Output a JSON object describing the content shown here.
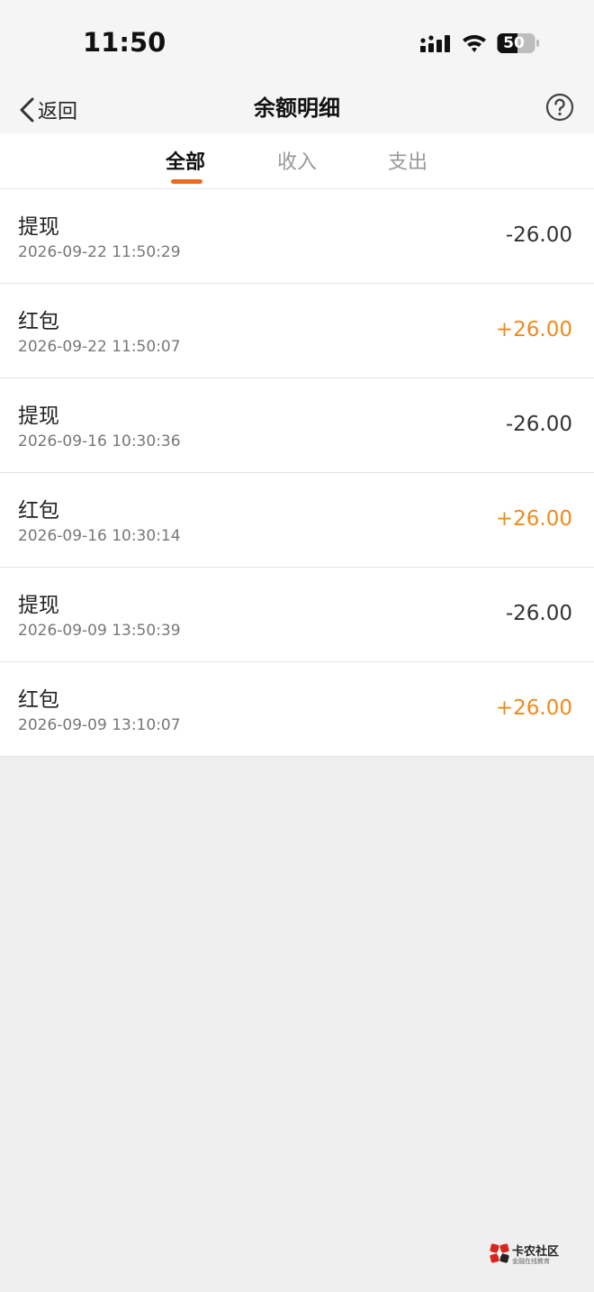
{
  "status_bar": {
    "time": "11:50",
    "battery": "50",
    "icons": [
      "signal-icon",
      "wifi-icon",
      "battery-icon"
    ]
  },
  "nav": {
    "back_label": "返回",
    "title": "余额明细",
    "help_icon": "question-circle-icon"
  },
  "tabs": [
    {
      "label": "全部",
      "active": true
    },
    {
      "label": "收入",
      "active": false
    },
    {
      "label": "支出",
      "active": false
    }
  ],
  "transactions": [
    {
      "title": "提现",
      "time": "2026-09-22 11:50:29",
      "amount": "-26.00"
    },
    {
      "title": "红包",
      "time": "2026-09-22 11:50:07",
      "amount": "+26.00"
    },
    {
      "title": "提现",
      "time": "2026-09-16 10:30:36",
      "amount": "-26.00"
    },
    {
      "title": "红包",
      "time": "2026-09-16 10:30:14",
      "amount": "+26.00"
    },
    {
      "title": "提现",
      "time": "2026-09-09 13:50:39",
      "amount": "-26.00"
    },
    {
      "title": "红包",
      "time": "2026-09-09 13:10:07",
      "amount": "+26.00"
    }
  ],
  "watermark": {
    "name": "卡农社区",
    "subtitle": "金融在线教育"
  },
  "colors": {
    "accent": "#f06a1e",
    "income": "#f08a1a",
    "expense": "#333333",
    "background": "#efefef"
  }
}
